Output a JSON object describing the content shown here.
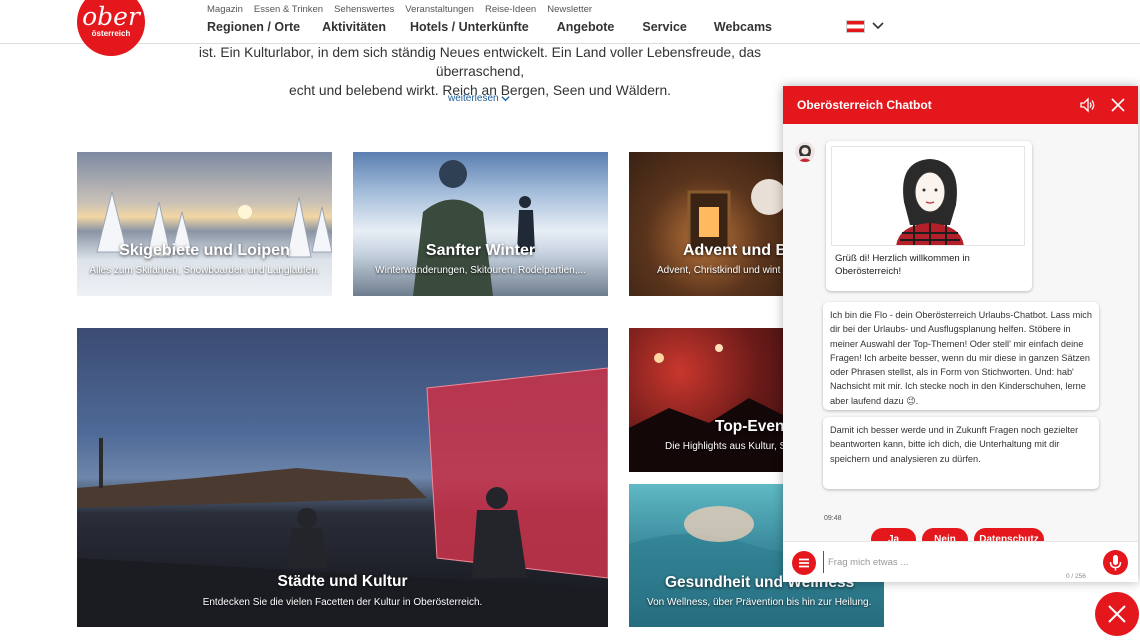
{
  "brand": {
    "logo_line1": "ober",
    "logo_line2": "österreich",
    "accent": "#e3171c"
  },
  "topnav": [
    "Magazin",
    "Essen & Trinken",
    "Sehenswertes",
    "Veranstaltungen",
    "Reise-Ideen",
    "Newsletter"
  ],
  "mainnav": [
    "Regionen / Orte",
    "Aktivitäten",
    "Hotels / Unterkünfte",
    "Angebote",
    "Service",
    "Webcams"
  ],
  "language": {
    "flag": "austria-flag-icon"
  },
  "intro": {
    "line1": "ist. Ein Kulturlabor, in dem sich ständig Neues entwickelt. Ein Land voller Lebensfreude, das überraschend,",
    "line2": "echt und belebend wirkt. Reich an Bergen, Seen und Wäldern.",
    "more": "weiterlesen"
  },
  "tiles": [
    {
      "title": "Skigebiete und Loipen",
      "subtitle": "Alles zum Skifahren, Snowboarden und Langlaufen."
    },
    {
      "title": "Sanfter Winter",
      "subtitle": "Winterwanderungen, Skitouren, Rodelpartien,..."
    },
    {
      "title": "Advent und Br",
      "subtitle": "Advent, Christkindl und wint"
    },
    {
      "title": "Städte und Kultur",
      "subtitle": "Entdecken Sie die vielen Facetten der Kultur in Oberösterreich."
    },
    {
      "title": "Top-Even",
      "subtitle": "Die Highlights aus Kultur, S"
    },
    {
      "title": "Gesundheit und Wellness",
      "subtitle": "Von Wellness, über Prävention bis hin zur Heilung."
    }
  ],
  "chatbot": {
    "title": "Oberösterreich Chatbot",
    "welcome": "Grüß di! Herzlich willkommen in Oberösterreich!",
    "message1": "Ich bin die Flo - dein Oberösterreich Urlaubs-Chatbot. Lass mich dir bei der Urlaubs- und Ausflugsplanung helfen. Stöbere in meiner Auswahl der Top-Themen! Oder stell' mir einfach deine Fragen! Ich arbeite besser, wenn du mir diese in ganzen Sätzen oder Phrasen stellst, als in Form von Stichworten. Und: hab' Nachsicht mit mir. Ich stecke noch in den Kinderschuhen, lerne aber laufend dazu 😉.",
    "message2": "Damit ich besser werde und in Zukunft Fragen noch gezielter beantworten kann, bitte ich dich, die Unterhaltung mit dir speichern und analysieren zu dürfen.",
    "time": "09:48",
    "replies": [
      "Ja",
      "Nein",
      "Datenschutz"
    ],
    "input_placeholder": "Frag mich etwas ...",
    "counter": "0 / 256"
  }
}
